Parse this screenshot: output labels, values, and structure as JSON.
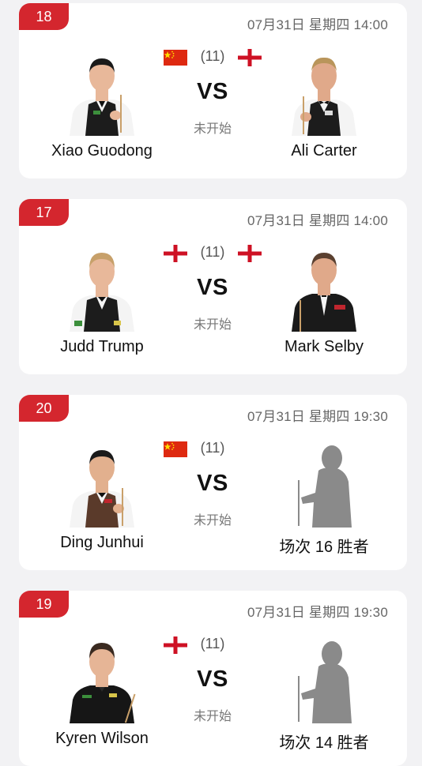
{
  "colors": {
    "accent": "#d4262e",
    "background": "#f2f2f4",
    "card": "#ffffff"
  },
  "matches": [
    {
      "number": "18",
      "datetime": "07月31日 星期四 14:00",
      "frames": "(11)",
      "vs": "VS",
      "status": "未开始",
      "left": {
        "name": "Xiao Guodong",
        "flag": "china-flag-icon",
        "photo": "player-photo"
      },
      "right": {
        "name": "Ali Carter",
        "flag": "england-flag-icon",
        "photo": "player-photo"
      }
    },
    {
      "number": "17",
      "datetime": "07月31日 星期四 14:00",
      "frames": "(11)",
      "vs": "VS",
      "status": "未开始",
      "left": {
        "name": "Judd Trump",
        "flag": "england-flag-icon",
        "photo": "player-photo"
      },
      "right": {
        "name": "Mark Selby",
        "flag": "england-flag-icon",
        "photo": "player-photo"
      }
    },
    {
      "number": "20",
      "datetime": "07月31日 星期四 19:30",
      "frames": "(11)",
      "vs": "VS",
      "status": "未开始",
      "left": {
        "name": "Ding Junhui",
        "flag": "china-flag-icon",
        "photo": "player-photo"
      },
      "right": {
        "name": "场次 16 胜者",
        "flag": "",
        "photo": "placeholder-silhouette"
      }
    },
    {
      "number": "19",
      "datetime": "07月31日 星期四 19:30",
      "frames": "(11)",
      "vs": "VS",
      "status": "未开始",
      "left": {
        "name": "Kyren Wilson",
        "flag": "england-flag-icon",
        "photo": "player-photo"
      },
      "right": {
        "name": "场次 14 胜者",
        "flag": "",
        "photo": "placeholder-silhouette"
      }
    }
  ]
}
